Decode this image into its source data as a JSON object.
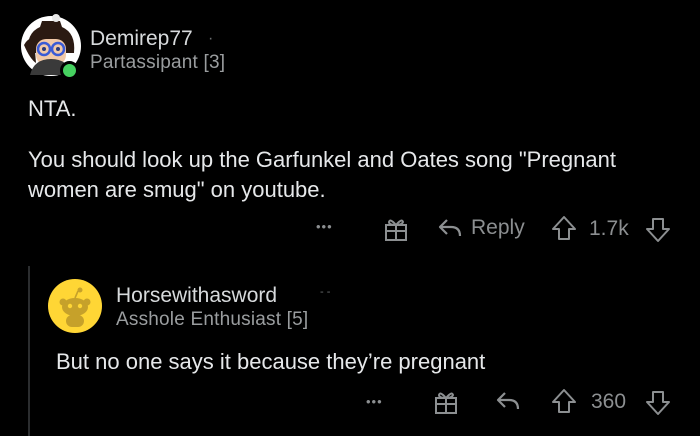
{
  "colors": {
    "background": "#000000",
    "text": "#d7dadc",
    "muted": "#8c8f91",
    "online": "#46d160",
    "avatar2_bg": "#ffd635"
  },
  "comment1": {
    "username": "Demirep77",
    "separator": "·",
    "flair": "Partassipant [3]",
    "avatar_icon": "snoo-avatar-witch",
    "body": [
      "NTA.",
      "You should look up the Garfunkel and Oates song \"Pregnant women are smug\" on youtube."
    ],
    "actions": {
      "more": "•••",
      "gift_icon": "gift-icon",
      "reply_label": "Reply",
      "score": "1.7k"
    }
  },
  "comment2": {
    "username": "Horsewithasword",
    "separator": "- -",
    "flair": "Asshole Enthusiast [5]",
    "avatar_icon": "default-snoo-avatar",
    "body": "But no one says it because they’re pregnant",
    "actions": {
      "more": "•••",
      "gift_icon": "gift-icon",
      "score": "360"
    }
  }
}
